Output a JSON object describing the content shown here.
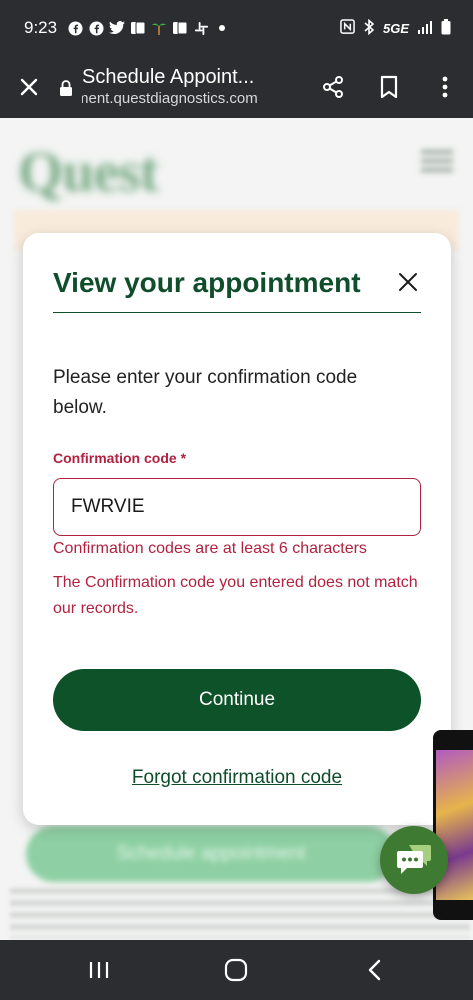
{
  "status_bar": {
    "time": "9:23",
    "network": "5GE"
  },
  "browser": {
    "title": "Schedule Appoint...",
    "url": "ment.questdiagnostics.com"
  },
  "background_page": {
    "logo": "Quest",
    "button_label": "Schedule appointment"
  },
  "modal": {
    "title": "View your appointment",
    "intro": "Please enter your confirmation code below.",
    "field_label": "Confirmation code",
    "required_mark": "*",
    "field_value": "FWRVIE",
    "error_length": "Confirmation codes are at least 6 characters",
    "error_mismatch": "The Confirmation code you entered does not match our records.",
    "continue_label": "Continue",
    "forgot_label": "Forgot confirmation code"
  },
  "colors": {
    "brand_green": "#0d5228",
    "error_red": "#b0223f",
    "chat_green": "#3e7a31",
    "system_bar": "#2b2d30"
  },
  "icons": {
    "close": "close-icon",
    "lock": "lock-icon",
    "share": "share-icon",
    "bookmark": "bookmark-icon",
    "more": "more-vertical-icon",
    "chat": "chat-icon",
    "nav_recent": "recent-apps-icon",
    "nav_home": "home-icon",
    "nav_back": "back-icon"
  }
}
